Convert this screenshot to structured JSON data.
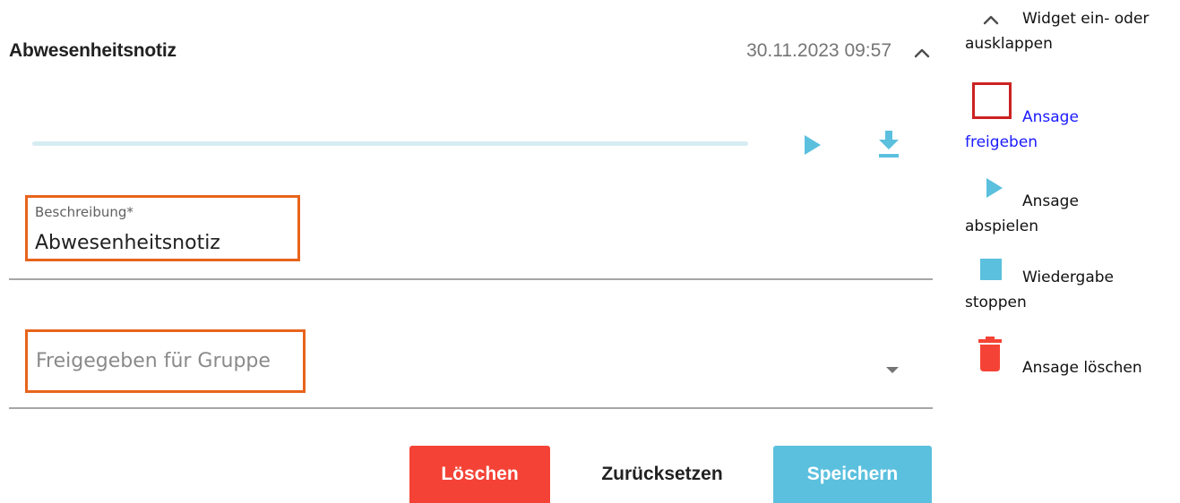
{
  "widget": {
    "title": "Abwesenheitsnotiz",
    "datetime": "30.11.2023 09:57",
    "playback_progress": 0
  },
  "form": {
    "description": {
      "label": "Beschreibung*",
      "value": "Abwesenheitsnotiz"
    },
    "group": {
      "placeholder": "Freigegeben für Gruppe"
    }
  },
  "actions": {
    "delete_label": "Löschen",
    "reset_label": "Zurücksetzen",
    "save_label": "Speichern"
  },
  "legend": {
    "collapse": {
      "icon": "chevron-up-icon",
      "line1": "Widget ein- oder",
      "line2": "ausklappen"
    },
    "share": {
      "icon": "share-checkbox-icon",
      "line1": "Ansage",
      "line2": "freigeben"
    },
    "play": {
      "icon": "play-icon",
      "line1": "Ansage",
      "line2": "abspielen"
    },
    "stop": {
      "icon": "stop-icon",
      "line1": "Wiedergabe",
      "line2": "stoppen"
    },
    "delete": {
      "icon": "trash-icon",
      "line1": "Ansage löschen"
    }
  },
  "colors": {
    "accent": "#5bc0de",
    "danger": "#f44336",
    "highlight": "#e8641c",
    "link": "#1a1aff"
  }
}
